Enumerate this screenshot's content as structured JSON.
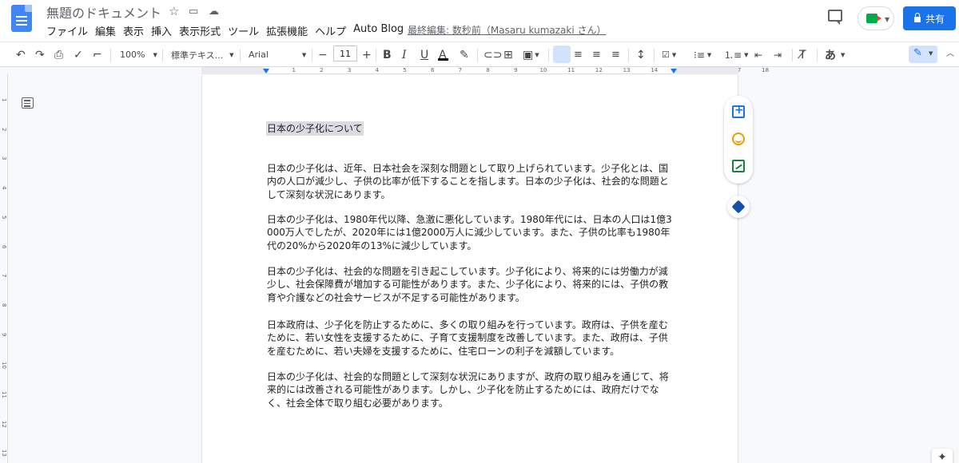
{
  "window": {
    "doc_title": "無題のドキュメント",
    "last_edit": "最終編集: 数秒前（Masaru kumazaki さん）",
    "share_label": "共有"
  },
  "menu": [
    "ファイル",
    "編集",
    "表示",
    "挿入",
    "表示形式",
    "ツール",
    "拡張機能",
    "ヘルプ",
    "Auto Blog"
  ],
  "toolbar": {
    "zoom": "100%",
    "style": "標準テキス...",
    "font": "Arial",
    "font_size": "11",
    "ime": "あ"
  },
  "ruler": {
    "labels": [
      "2",
      "1",
      "1",
      "2",
      "3",
      "4",
      "5",
      "6",
      "7",
      "8",
      "9",
      "10",
      "11",
      "12",
      "13",
      "14",
      "15",
      "16",
      "17",
      "18"
    ],
    "vlabels": [
      "1",
      "2",
      "3",
      "4",
      "5",
      "6",
      "7",
      "8",
      "9",
      "10",
      "11",
      "12",
      "13"
    ]
  },
  "document": {
    "heading": "日本の少子化について",
    "paragraphs": [
      "日本の少子化は、近年、日本社会を深刻な問題として取り上げられています。少子化とは、国内の人口が減少し、子供の比率が低下することを指します。日本の少子化は、社会的な問題として深刻な状況にあります。",
      "日本の少子化は、1980年代以降、急激に悪化しています。1980年代には、日本の人口は1億3000万人でしたが、2020年には1億2000万人に減少しています。また、子供の比率も1980年代の20%から2020年の13%に減少しています。",
      "日本の少子化は、社会的な問題を引き起こしています。少子化により、将来的には労働力が減少し、社会保障費が増加する可能性があります。また、少子化により、将来的には、子供の教育や介護などの社会サービスが不足する可能性があります。",
      "日本政府は、少子化を防止するために、多くの取り組みを行っています。政府は、子供を産むために、若い女性を支援するために、子育て支援制度を改善しています。また、政府は、子供を産むために、若い夫婦を支援するために、住宅ローンの利子を減額しています。",
      "日本の少子化は、社会的な問題として深刻な状況にありますが、政府の取り組みを通じて、将来的には改善される可能性があります。しかし、少子化を防止するためには、政府だけでなく、社会全体で取り組む必要があります。"
    ]
  },
  "colors": {
    "accent": "#1a73e8",
    "page_bg": "#f8f9fa"
  }
}
